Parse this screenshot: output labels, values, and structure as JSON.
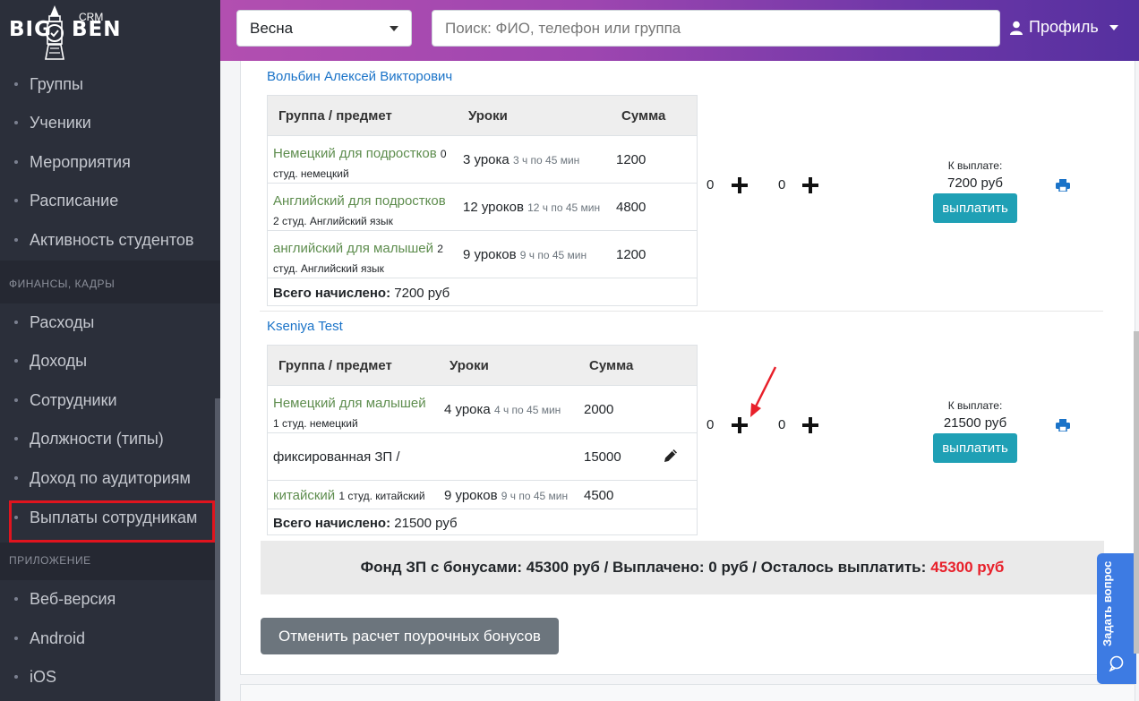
{
  "brand": {
    "name_part1": "BIG",
    "name_part2": "BEN",
    "suffix": "CRM"
  },
  "sidebar": {
    "group1": [
      {
        "label": "Группы"
      },
      {
        "label": "Ученики"
      },
      {
        "label": "Мероприятия"
      },
      {
        "label": "Расписание"
      },
      {
        "label": "Активность студентов"
      }
    ],
    "header_finance": "ФИНАНСЫ, КАДРЫ",
    "group2": [
      {
        "label": "Расходы"
      },
      {
        "label": "Доходы"
      },
      {
        "label": "Сотрудники"
      },
      {
        "label": "Должности (типы)"
      },
      {
        "label": "Доход по аудиториям"
      },
      {
        "label": "Выплаты сотрудникам"
      }
    ],
    "header_app": "ПРИЛОЖЕНИЕ",
    "group3": [
      {
        "label": "Веб-версия"
      },
      {
        "label": "Android"
      },
      {
        "label": "iOS"
      }
    ]
  },
  "header": {
    "season": "Весна",
    "search_placeholder": "Поиск: ФИО, телефон или группа",
    "profile_label": "Профиль"
  },
  "columns": {
    "group": "Группа / предмет",
    "lessons": "Уроки",
    "sum": "Сумма"
  },
  "employees": [
    {
      "name": "Вольбин Алексей Викторович",
      "rows": [
        {
          "group": "Немецкий для подростков",
          "group_meta": "0",
          "group_sub": "студ. немецкий",
          "lessons": "3 урока",
          "lessons_meta": "3 ч по 45 мин",
          "sum": "1200"
        },
        {
          "group": "Английский для подростков",
          "group_sub": "2 студ. Английский язык",
          "lessons": "12 уроков",
          "lessons_meta": "12 ч по 45 мин",
          "sum": "4800"
        },
        {
          "group": "английский для малышей",
          "group_meta": "2",
          "group_sub": "студ. Английский язык",
          "lessons": "9 уроков",
          "lessons_meta": "9 ч по 45 мин",
          "sum": "1200"
        }
      ],
      "total_label": "Всего начислено:",
      "total_value": "7200 руб",
      "bonus_a": "0",
      "bonus_b": "0",
      "pay_label": "К выплате:",
      "pay_amount": "7200 руб",
      "pay_button": "выплатить"
    },
    {
      "name": "Kseniya Test",
      "rows": [
        {
          "group": "Немецкий для малышей",
          "group_sub": "1 студ. немецкий",
          "lessons": "4 урока",
          "lessons_meta": "4 ч по 45 мин",
          "sum": "2000"
        },
        {
          "group": "фиксированная ЗП /",
          "sum": "15000"
        },
        {
          "group": "китайский",
          "group_sub": "1 студ. китайский",
          "lessons": "9 уроков",
          "lessons_meta": "9 ч по 45 мин",
          "sum": "4500"
        }
      ],
      "total_label": "Всего начислено:",
      "total_value": "21500 руб",
      "bonus_a": "0",
      "bonus_b": "0",
      "pay_label": "К выплате:",
      "pay_amount": "21500 руб",
      "pay_button": "выплатить"
    }
  ],
  "fund": {
    "text": "Фонд ЗП с бонусами: 45300 руб / Выплачено: 0 руб / Осталось выплатить:",
    "remaining": "45300 руб"
  },
  "cancel_button": "Отменить расчет поурочных бонусов",
  "ask_button": "Задать вопрос",
  "colors": {
    "accent_pay": "#1fa0b5",
    "link": "#1a73c8",
    "group_link": "#5e8d4e",
    "remaining": "#e8202a",
    "highlight": "#e0141e"
  }
}
